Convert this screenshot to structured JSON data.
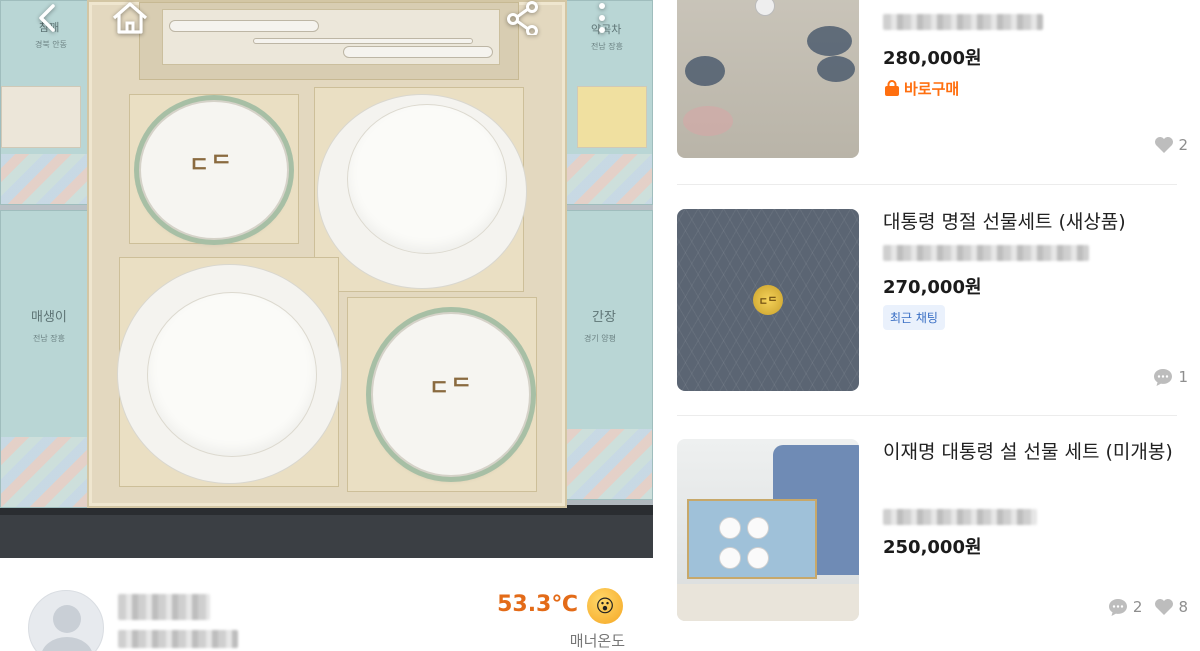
{
  "left": {
    "box_labels": {
      "left_box_title": "매생이",
      "left_box_sub": "전남 장흥",
      "top_left_title": "참깨",
      "top_left_sub": "경북 안동",
      "right_box_title": "간장",
      "right_box_sub": "경기 양평",
      "top_right_title": "약곡차",
      "top_right_sub": "전남 장흥"
    },
    "emblem": "ㄷᄃ",
    "seller": {
      "manner_temperature": "53.3℃",
      "manner_label": "매너온도",
      "emoji": "😮"
    }
  },
  "right": {
    "items": [
      {
        "title": "",
        "price": "280,000원",
        "badge": "바로구매",
        "likes": "2"
      },
      {
        "title": "대통령 명절 선물세트 (새상품)",
        "price": "270,000원",
        "badge": "최근 채팅",
        "comments": "1"
      },
      {
        "title": "이재명 대통령 설 선물 세트 (미개봉)",
        "price": "250,000원",
        "comments": "2",
        "likes": "8"
      }
    ],
    "thumb2_coin": "ㄷᄃ"
  },
  "icons": {
    "back": "chevron-left-icon",
    "home": "home-icon",
    "share": "share-icon",
    "more": "more-vertical-icon",
    "heart": "heart-icon",
    "chat": "chat-bubble-icon",
    "buy": "shopping-bag-icon"
  },
  "colors": {
    "accent_orange": "#ff6f0f",
    "temperature_orange": "#e36b18",
    "chat_tag_blue": "#3a6fc4"
  }
}
